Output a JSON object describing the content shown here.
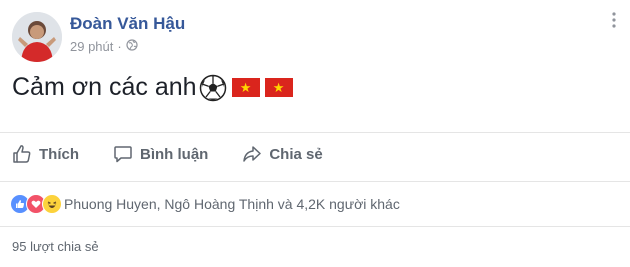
{
  "post": {
    "author": "Đoàn Văn Hậu",
    "time": "29 phút",
    "separator": "·",
    "privacy_icon": "globe-icon",
    "more_icon": "more-dots-icon",
    "text": "Cảm ơn các anh",
    "emojis": [
      "soccer-ball-icon",
      "vietnam-flag-icon",
      "vietnam-flag-icon"
    ]
  },
  "actions": {
    "like_label": "Thích",
    "comment_label": "Bình luận",
    "share_label": "Chia sẻ"
  },
  "reactions": {
    "icons": [
      "like-reaction-icon",
      "love-reaction-icon",
      "haha-reaction-icon"
    ],
    "text": "Phuong Huyen, Ngô Hoàng Thịnh và 4,2K người khác"
  },
  "shares": {
    "text": "95 lượt chia sẻ"
  },
  "colors": {
    "author": "#365899",
    "meta": "#90949c",
    "action": "#606770",
    "flag_red": "#da251d",
    "flag_star": "#ffd600",
    "like_blue": "#5890ff",
    "love_red": "#f25268",
    "haha_yellow": "#fcd23c"
  }
}
